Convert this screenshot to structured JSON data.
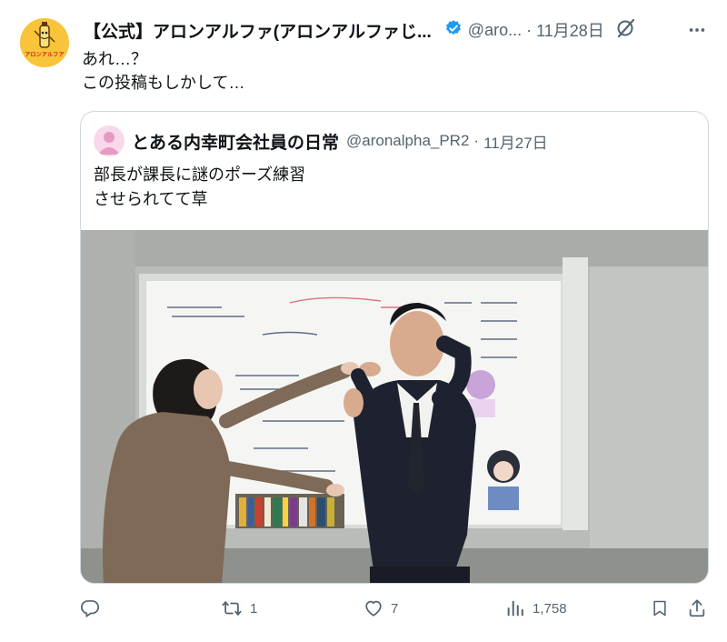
{
  "post": {
    "author": {
      "display_name": "【公式】アロンアルファ(アロンアルファじ...",
      "handle": "@aro...",
      "avatar_brand": "アロンアルフア",
      "avatar_icon": "aron-alpha-mascot-icon"
    },
    "separator": "·",
    "date": "11月28日",
    "text_lines": [
      "あれ…？",
      "この投稿もしかして…"
    ],
    "verified_color": "#1d9bf0"
  },
  "quote": {
    "author": {
      "display_name": "とある内幸町会社員の日常",
      "handle": "@aronalpha_PR2",
      "avatar_icon": "default-person-icon"
    },
    "date": "11月27日",
    "text_lines": [
      "部長が課長に謎のポーズ練習",
      "させられてて草"
    ],
    "media": {
      "description_icon": "photo-office-whiteboard-pose"
    }
  },
  "actions": {
    "reply": {
      "icon": "reply-icon",
      "count": ""
    },
    "repost": {
      "icon": "repost-icon",
      "count": "1"
    },
    "like": {
      "icon": "heart-icon",
      "count": "7"
    },
    "views": {
      "icon": "views-bar-icon",
      "count": "1,758"
    },
    "bookmark": {
      "icon": "bookmark-icon"
    },
    "share": {
      "icon": "share-icon"
    }
  },
  "colors": {
    "text_primary": "#0f1419",
    "text_secondary": "#536471",
    "border": "#cfd9de",
    "verified": "#1d9bf0",
    "avatar_bg": "#f7c43a"
  }
}
